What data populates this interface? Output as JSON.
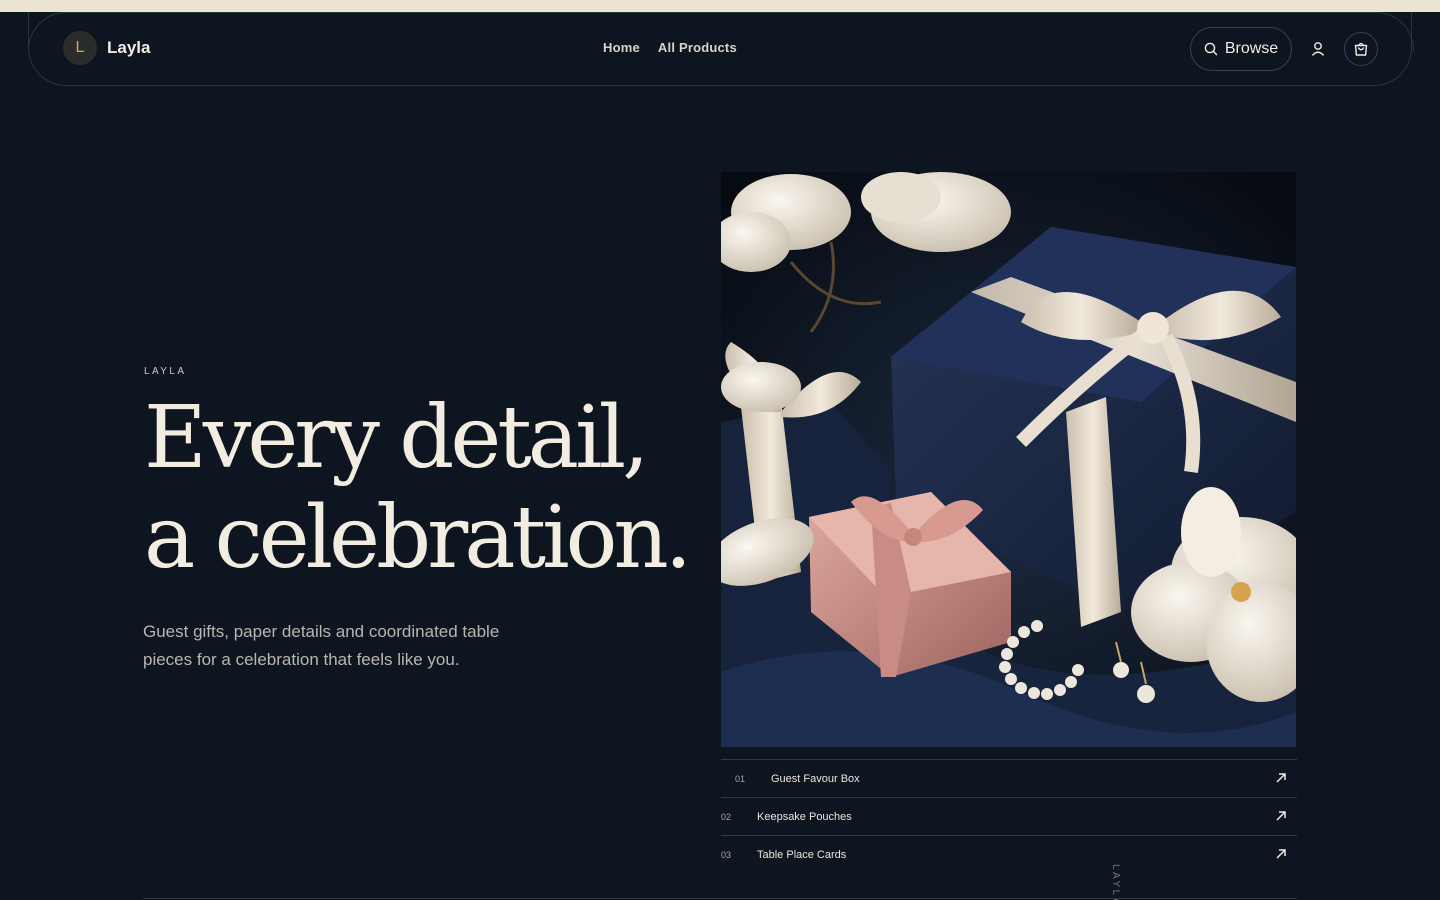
{
  "brand": {
    "initial": "L",
    "name": "Layla"
  },
  "nav": {
    "links": [
      "Home",
      "All Products"
    ]
  },
  "header_actions": {
    "browse_label": "Browse",
    "icons": [
      "search-icon",
      "account-icon",
      "cart-icon"
    ]
  },
  "hero": {
    "eyebrow": "LAYLA",
    "headline_line1": "Every detail,",
    "headline_line2": "a celebration.",
    "subcopy": "Guest gifts, paper details and coordinated table pieces for a celebration that feels like you."
  },
  "products": [
    {
      "num": "01",
      "label": "Guest Favour Box"
    },
    {
      "num": "02",
      "label": "Keepsake Pouches"
    },
    {
      "num": "03",
      "label": "Table Place Cards"
    }
  ],
  "vertical_label": "LAYLA",
  "colors": {
    "background": "#0c1520",
    "cream": "#f3ece0",
    "accent_gold": "#d6a64e",
    "topbar": "#ece3d3"
  }
}
